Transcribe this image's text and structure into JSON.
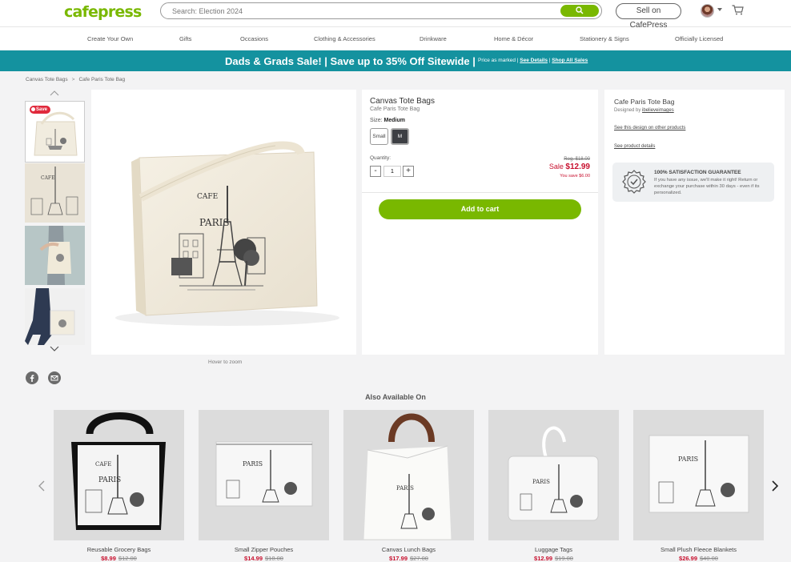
{
  "header": {
    "logo": "cafepress",
    "search_placeholder": "Search: Election 2024",
    "sell_label": "Sell on CafePress"
  },
  "nav": [
    "Create Your Own",
    "Gifts",
    "Occasions",
    "Clothing & Accessories",
    "Drinkware",
    "Home & Décor",
    "Stationery & Signs",
    "Officially Licensed"
  ],
  "banner": {
    "headline": "Dads & Grads Sale! | Save up to 35% Off Sitewide |",
    "note": "Price as marked |",
    "details_link": "See Details",
    "sep": "|",
    "all_sales_link": "Shop All Sales"
  },
  "breadcrumb": {
    "items": [
      "Canvas Tote Bags",
      "Cafe Paris Tote Bag"
    ],
    "separator": ">"
  },
  "gallery": {
    "save_badge": "Save",
    "hover_hint": "Hover to zoom"
  },
  "product": {
    "title": "Canvas Tote Bags",
    "subtitle": "Cafe Paris Tote Bag",
    "size_label": "Size:",
    "size_selected": "Medium",
    "sizes": [
      "Small",
      "M"
    ],
    "quantity_label": "Quantity:",
    "quantity_value": "1",
    "qty_minus": "-",
    "qty_plus": "+",
    "regular_price": "Reg. $18.00",
    "sale_label": "Sale",
    "sale_price": "$12.99",
    "you_save": "You save $6.00",
    "add_to_cart": "Add to cart"
  },
  "design": {
    "name": "Cafe Paris Tote Bag",
    "designed_by_label": "Designed by",
    "designer": "ibelieveimages",
    "other_products_link": "See this design on other products",
    "details_link": "See product details",
    "guarantee_title": "100% SATISFACTION GUARANTEE",
    "guarantee_text": "If you have any issue, we'll make it right! Return or exchange your purchase within 30 days - even if its personalized."
  },
  "also_available": {
    "title": "Also Available On",
    "products": [
      {
        "name": "Reusable Grocery Bags",
        "sale": "$8.99",
        "reg": "$12.00"
      },
      {
        "name": "Small Zipper Pouches",
        "sale": "$14.99",
        "reg": "$18.00"
      },
      {
        "name": "Canvas Lunch Bags",
        "sale": "$17.99",
        "reg": "$27.00"
      },
      {
        "name": "Luggage Tags",
        "sale": "$12.99",
        "reg": "$19.00"
      },
      {
        "name": "Small Plush Fleece Blankets",
        "sale": "$26.99",
        "reg": "$40.00"
      }
    ]
  },
  "colors": {
    "brand_green": "#79b800",
    "banner_teal": "#14929f",
    "sale_red": "#c8102e"
  }
}
